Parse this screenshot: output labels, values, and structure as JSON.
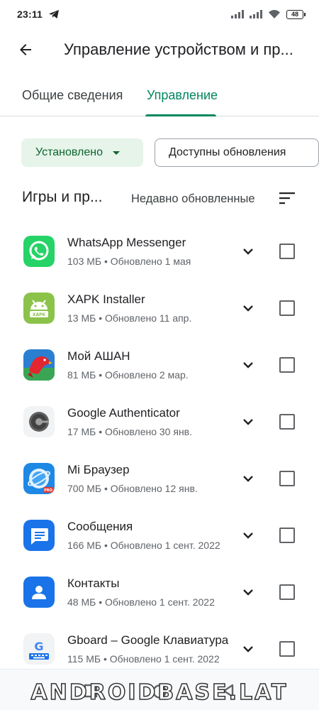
{
  "status": {
    "time": "23:11",
    "battery": "48",
    "icons": [
      "telegram-icon",
      "signal-icon",
      "signal-icon",
      "wifi-icon",
      "battery-icon"
    ]
  },
  "appbar": {
    "title": "Управление устройством и пр...",
    "back_icon": "arrow-back-icon"
  },
  "tabs": [
    {
      "label": "Общие сведения"
    },
    {
      "label": "Управление"
    }
  ],
  "filters": {
    "installed_label": "Установлено",
    "updates_label": "Доступны обновления"
  },
  "section": {
    "title": "Игры и пр...",
    "sort_label": "Недавно обновленные",
    "sort_icon": "sort-icon"
  },
  "apps": [
    {
      "name": "WhatsApp Messenger",
      "meta": "103 МБ  •  Обновлено 1 мая",
      "icon": "whatsapp-icon",
      "color": "#25d366"
    },
    {
      "name": "XAPK Installer",
      "meta": "13 МБ  •  Обновлено 11 апр.",
      "icon": "xapk-android-icon",
      "color": "#8bc34a"
    },
    {
      "name": "Мой АШАН",
      "meta": "81 МБ  •  Обновлено 2 мар.",
      "icon": "auchan-bird-icon",
      "color": "#e3262f"
    },
    {
      "name": "Google Authenticator",
      "meta": "17 МБ  •  Обновлено 30 янв.",
      "icon": "authenticator-icon",
      "color": "#616161"
    },
    {
      "name": "Mi Браузер",
      "meta": "700 МБ  •  Обновлено 12 янв.",
      "icon": "mi-browser-icon",
      "color": "#2196f3"
    },
    {
      "name": "Сообщения",
      "meta": "166 МБ  •  Обновлено 1 сент. 2022",
      "icon": "messages-icon",
      "color": "#1a73e8"
    },
    {
      "name": "Контакты",
      "meta": "48 МБ  •  Обновлено 1 сент. 2022",
      "icon": "contacts-icon",
      "color": "#1a73e8"
    },
    {
      "name": "Gboard – Google Клавиатура",
      "meta": "115 МБ  •  Обновлено 1 сент. 2022",
      "icon": "gboard-icon",
      "color": "#4285f4"
    }
  ],
  "watermark": "ANDROIDBASE.LAT"
}
